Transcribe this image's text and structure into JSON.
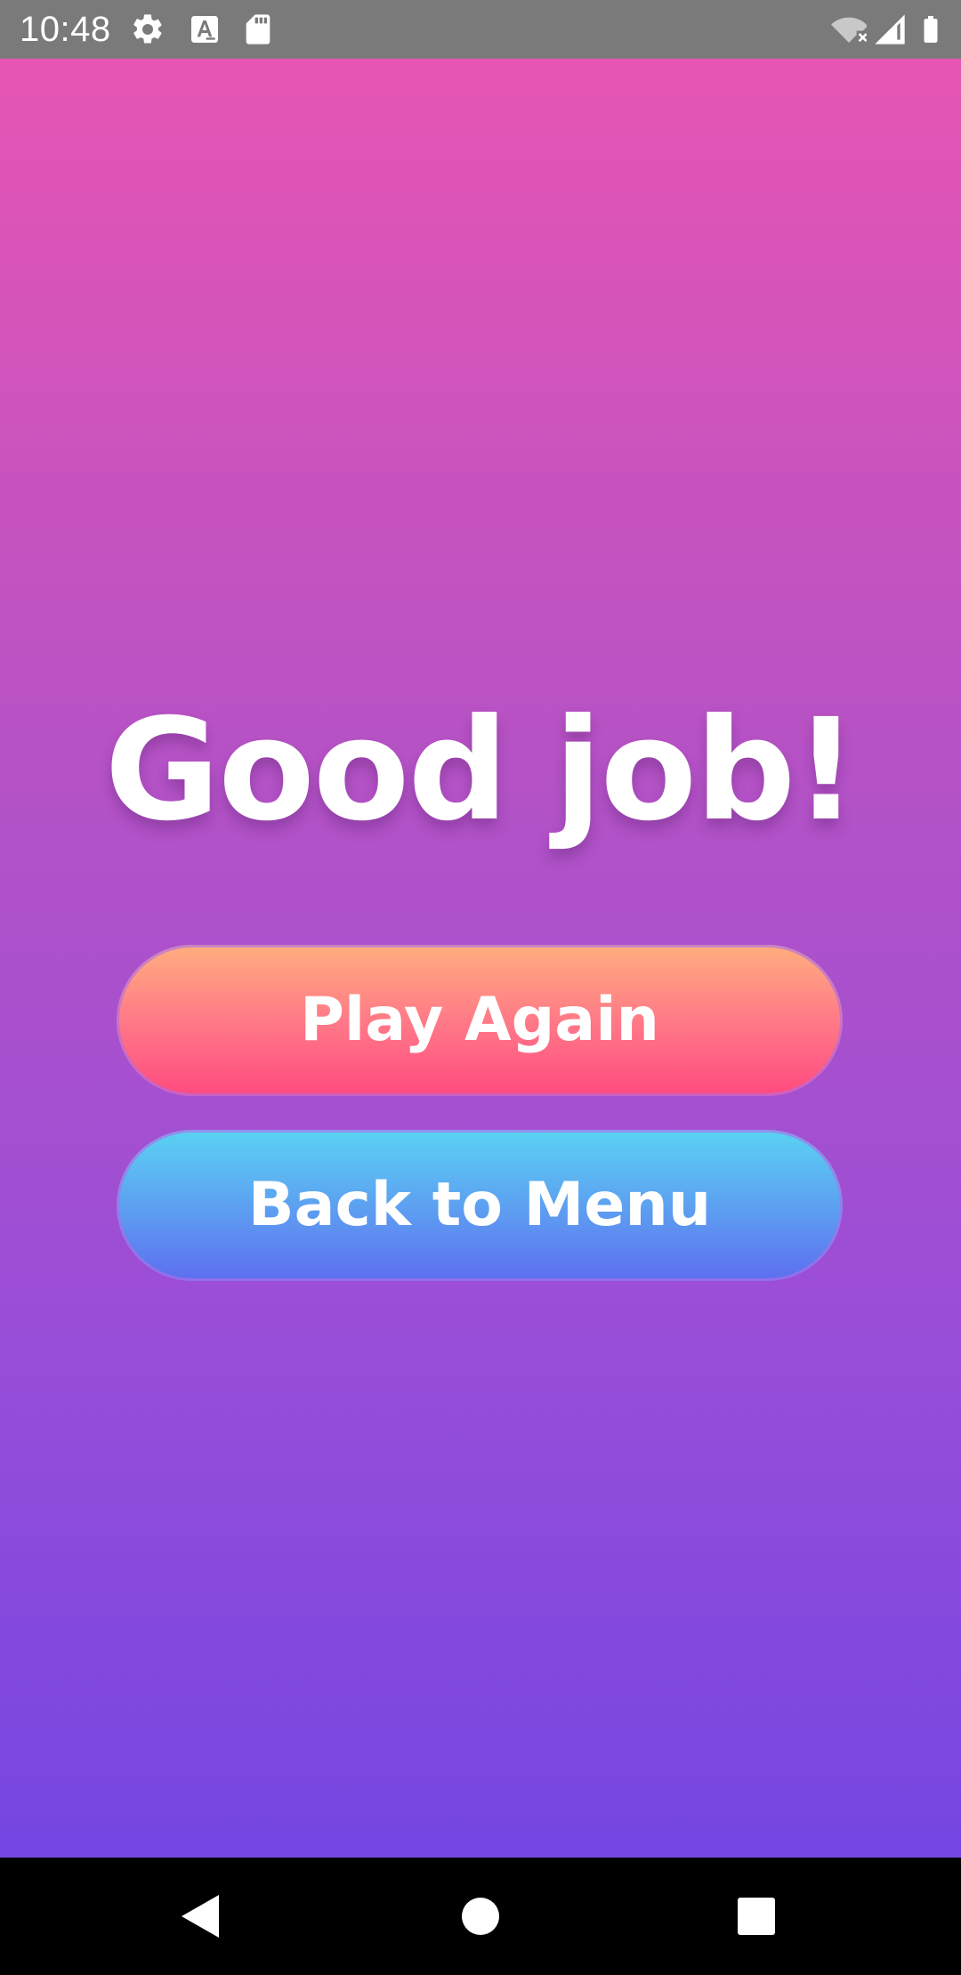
{
  "status_bar": {
    "time": "10:48",
    "icons_left": [
      "gear-icon",
      "text-a-icon",
      "sd-card-icon"
    ],
    "icons_right": [
      "wifi-off-icon",
      "cell-signal-icon",
      "battery-icon"
    ]
  },
  "main": {
    "headline": "Good job!",
    "play_again_label": "Play Again",
    "back_to_menu_label": "Back to Menu"
  },
  "nav_bar": {
    "buttons": [
      "back-icon",
      "home-icon",
      "recents-icon"
    ]
  },
  "colors": {
    "background_top": "#e655b3",
    "background_bottom": "#7446e2",
    "play_again_top": "#ffae7e",
    "play_again_bottom": "#ff4a80",
    "back_to_menu_top": "#5ad3f2",
    "back_to_menu_bottom": "#5d6ef0",
    "text": "#ffffff"
  }
}
